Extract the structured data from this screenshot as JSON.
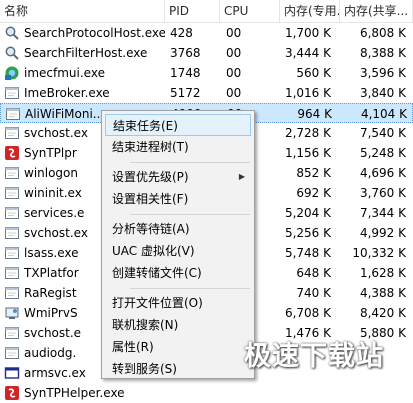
{
  "columns": [
    "名称",
    "PID",
    "CPU",
    "内存(专用...",
    "内存(共享..."
  ],
  "rows": [
    {
      "name": "SearchProtocolHost.exe",
      "pid": "428",
      "cpu": "00",
      "mem_private": "1,700 K",
      "mem_shared": "6,808 K",
      "icon": "magnifier-icon"
    },
    {
      "name": "SearchFilterHost.exe",
      "pid": "3768",
      "cpu": "00",
      "mem_private": "3,444 K",
      "mem_shared": "8,388 K",
      "icon": "magnifier-icon"
    },
    {
      "name": "imecfmui.exe",
      "pid": "1748",
      "cpu": "00",
      "mem_private": "560 K",
      "mem_shared": "3,596 K",
      "icon": "ime-icon"
    },
    {
      "name": "ImeBroker.exe",
      "pid": "5172",
      "cpu": "00",
      "mem_private": "1,016 K",
      "mem_shared": "3,840 K",
      "icon": "window-icon"
    },
    {
      "name": "AliWiFiMoni...",
      "pid": "4900",
      "cpu": "00",
      "mem_private": "964 K",
      "mem_shared": "4,104 K",
      "icon": "window-icon"
    },
    {
      "name": "svchost.ex",
      "pid": "",
      "cpu": "",
      "mem_private": "2,728 K",
      "mem_shared": "7,540 K",
      "icon": "window-icon"
    },
    {
      "name": "SynTPlpr",
      "pid": "",
      "cpu": "",
      "mem_private": "1,156 K",
      "mem_shared": "5,248 K",
      "icon": "synaptics-icon"
    },
    {
      "name": "winlogon",
      "pid": "",
      "cpu": "",
      "mem_private": "852 K",
      "mem_shared": "4,696 K",
      "icon": "window-icon"
    },
    {
      "name": "wininit.ex",
      "pid": "",
      "cpu": "",
      "mem_private": "692 K",
      "mem_shared": "3,760 K",
      "icon": "window-icon"
    },
    {
      "name": "services.e",
      "pid": "",
      "cpu": "",
      "mem_private": "5,204 K",
      "mem_shared": "7,344 K",
      "icon": "window-icon"
    },
    {
      "name": "svchost.ex",
      "pid": "",
      "cpu": "",
      "mem_private": "5,256 K",
      "mem_shared": "4,992 K",
      "icon": "window-icon"
    },
    {
      "name": "lsass.exe",
      "pid": "",
      "cpu": "",
      "mem_private": "5,748 K",
      "mem_shared": "10,332 K",
      "icon": "window-icon"
    },
    {
      "name": "TXPlatfor",
      "pid": "",
      "cpu": "",
      "mem_private": "648 K",
      "mem_shared": "1,628 K",
      "icon": "window-icon"
    },
    {
      "name": "RaRegist",
      "pid": "",
      "cpu": "",
      "mem_private": "740 K",
      "mem_shared": "4,388 K",
      "icon": "window-icon"
    },
    {
      "name": "WmiPrvS",
      "pid": "",
      "cpu": "",
      "mem_private": "6,708 K",
      "mem_shared": "8,420 K",
      "icon": "wmi-icon"
    },
    {
      "name": "svchost.e",
      "pid": "",
      "cpu": "",
      "mem_private": "1,476 K",
      "mem_shared": "5,880 K",
      "icon": "window-icon"
    },
    {
      "name": "audiodg.",
      "pid": "",
      "cpu": "",
      "mem_private": "",
      "mem_shared": "",
      "icon": "window-icon"
    },
    {
      "name": "armsvc.ex",
      "pid": "",
      "cpu": "",
      "mem_private": "",
      "mem_shared": "",
      "icon": "window-blue-icon"
    },
    {
      "name": "SynTPHelper.exe",
      "pid": "",
      "cpu": "",
      "mem_private": "",
      "mem_shared": "",
      "icon": "synaptics-icon"
    }
  ],
  "context_menu": {
    "end_task": "结束任务(E)",
    "end_tree": "结束进程树(T)",
    "set_priority": "设置优先级(P)",
    "set_affinity": "设置相关性(F)",
    "analyze_wait": "分析等待链(A)",
    "uac_virtual": "UAC 虚拟化(V)",
    "create_dump": "创建转储文件(C)",
    "open_location": "打开文件位置(O)",
    "search_online": "联机搜索(N)",
    "properties": "属性(R)",
    "goto_service": "转到服务(S)"
  },
  "watermark": "极速下载站"
}
